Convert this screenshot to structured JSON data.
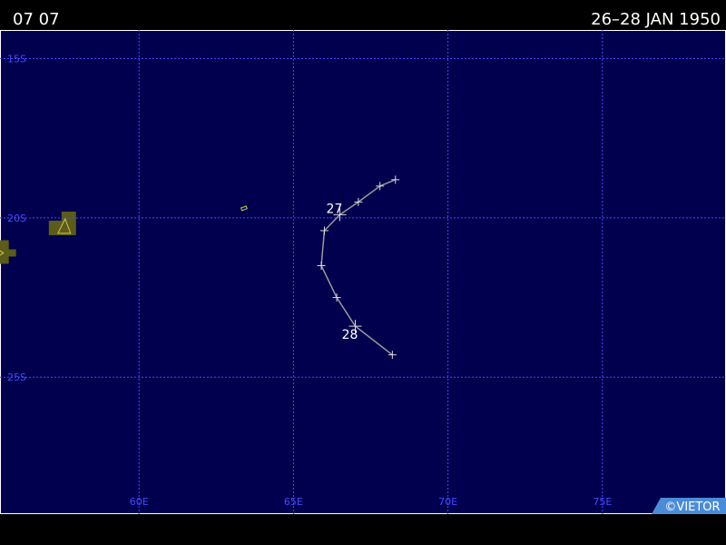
{
  "header": {
    "storm_id": "07 07",
    "date_range": "26–28 JAN 1950"
  },
  "map": {
    "lon_range": [
      55.5,
      79.0
    ],
    "lat_range": [
      -29.3,
      -14.1
    ],
    "grid": {
      "lat_lines": [
        -15,
        -20,
        -25
      ],
      "lon_lines": [
        60,
        65,
        70,
        75
      ],
      "lat_labels": [
        "15S",
        "20S",
        "25S"
      ],
      "lon_labels": [
        "60E",
        "65E",
        "70E",
        "75E"
      ]
    },
    "colors": {
      "ocean": "#00004e",
      "grid": "#4848ff",
      "land": "#5b5b1a",
      "land_outline": "#c8c84b",
      "track": "#9a9a9a",
      "marker": "#d8d8d8",
      "frame": "#ffffff"
    },
    "land": [
      {
        "name": "reunion",
        "center": [
          55.55,
          -21.1
        ]
      },
      {
        "name": "mauritius",
        "center": [
          57.55,
          -20.2
        ]
      },
      {
        "name": "cargados-carajos",
        "center": [
          63.4,
          -19.7
        ]
      }
    ]
  },
  "track": {
    "points": [
      [
        68.3,
        -18.8
      ],
      [
        67.8,
        -19.0
      ],
      [
        67.1,
        -19.5
      ],
      [
        66.5,
        -19.9
      ],
      [
        66.0,
        -20.4
      ],
      [
        65.9,
        -21.5
      ],
      [
        66.4,
        -22.5
      ],
      [
        67.0,
        -23.4
      ],
      [
        68.2,
        -24.3
      ]
    ],
    "day_labels": [
      {
        "text": "27",
        "at": [
          66.5,
          -19.9
        ]
      },
      {
        "text": "28",
        "at": [
          67.0,
          -23.4
        ]
      }
    ]
  },
  "credit": "©VIETOR"
}
